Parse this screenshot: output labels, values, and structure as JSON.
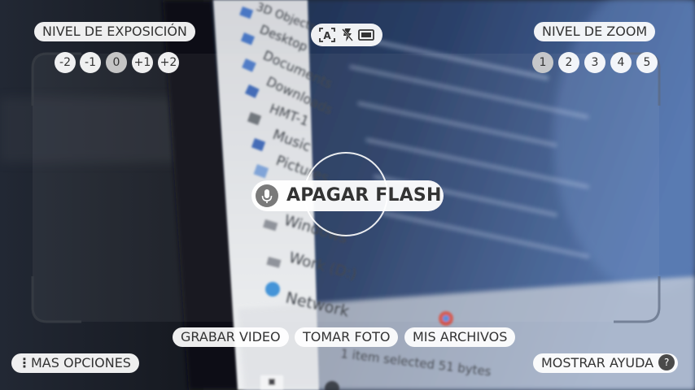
{
  "exposure": {
    "title": "NIVEL DE EXPOSICIÓN",
    "levels": [
      "-2",
      "-1",
      "0",
      "+1",
      "+2"
    ],
    "selected": "0"
  },
  "zoom": {
    "title": "NIVEL DE ZOOM",
    "levels": [
      "1",
      "2",
      "3",
      "4",
      "5"
    ],
    "selected": "1"
  },
  "voice_command": {
    "text": "APAGAR FLASH"
  },
  "bottom_bar": {
    "record_video": "GRABAR VIDEO",
    "take_photo": "TOMAR FOTO",
    "my_files": "MIS ARCHIVOS"
  },
  "more_options": "MAS OPCIONES",
  "show_help": "MOSTRAR AYUDA",
  "help_glyph": "?",
  "viewfinder_text": {
    "folders": [
      "3D Objects",
      "Desktop",
      "Documents",
      "Downloads",
      "HMT-1",
      "Music",
      "Pictures",
      "Windows",
      "Work (D:)",
      "Network"
    ],
    "status": "1 item selected  51 bytes"
  },
  "colors": {
    "pill_bg": "#ffffff",
    "pill_text": "#333333",
    "selected_level_bg": "#cdcdcd",
    "mic_bg": "#7a7a7a"
  }
}
